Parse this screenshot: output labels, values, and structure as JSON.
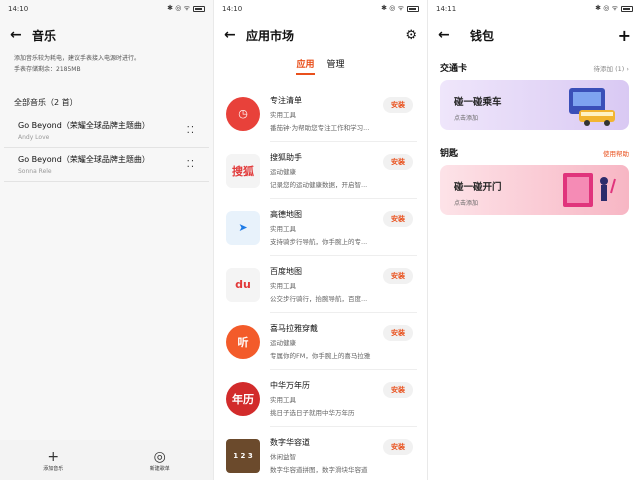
{
  "panel1": {
    "time": "14:10",
    "title": "音乐",
    "tip": "添加音乐较为耗电，建议手表接入电源时进行。",
    "storage": "手表存储剩余：2185MB",
    "all_music": "全部音乐（2 首）",
    "songs": [
      {
        "title": "Go Beyond（荣耀全球品牌主题曲）",
        "artist": "Andy Love"
      },
      {
        "title": "Go Beyond（荣耀全球品牌主题曲）",
        "artist": "Sonna Rele"
      }
    ],
    "add_music": "添加音乐",
    "new_playlist": "新建歌单"
  },
  "panel2": {
    "time": "14:10",
    "title": "应用市场",
    "tab_apps": "应用",
    "tab_manage": "管理",
    "install": "安装",
    "apps": [
      {
        "name": "专注清单",
        "cat": "实用工具",
        "desc": "番茄钟·为帮助您专注工作和学习...",
        "color": "#e8413a",
        "glyph": "◷"
      },
      {
        "name": "搜狐助手",
        "cat": "运动健康",
        "desc": "记录您的运动健康数据，开启智...",
        "color": "#f4f4f4",
        "glyph": "搜狐"
      },
      {
        "name": "高德地图",
        "cat": "实用工具",
        "desc": "支持骑步行导航，你手腕上的专...",
        "color": "#e8f2fb",
        "glyph": "➤"
      },
      {
        "name": "百度地图",
        "cat": "实用工具",
        "desc": "公交步行骑行，抬腕导航，百度...",
        "color": "#f4f4f4",
        "glyph": "du"
      },
      {
        "name": "喜马拉雅穿戴",
        "cat": "运动健康",
        "desc": "专属你的FM，你手腕上的喜马拉雅",
        "color": "#f35b2a",
        "glyph": "听"
      },
      {
        "name": "中华万年历",
        "cat": "实用工具",
        "desc": "挑日子选日子就用中华万年历",
        "color": "#d22b2b",
        "glyph": "年历"
      },
      {
        "name": "数字华容道",
        "cat": "休闲益智",
        "desc": "数字华容道拼图，数字滑块华容道",
        "color": "#6b4a2c",
        "glyph": "1 2 3"
      }
    ]
  },
  "panel3": {
    "time": "14:11",
    "title": "钱包",
    "transit_label": "交通卡",
    "transit_status": "待添加 (1)",
    "transit_card_title": "碰一碰乘车",
    "transit_card_sub": "点击添加",
    "key_label": "钥匙",
    "key_help": "使用帮助",
    "key_card_title": "碰一碰开门",
    "key_card_sub": "点击添加"
  }
}
